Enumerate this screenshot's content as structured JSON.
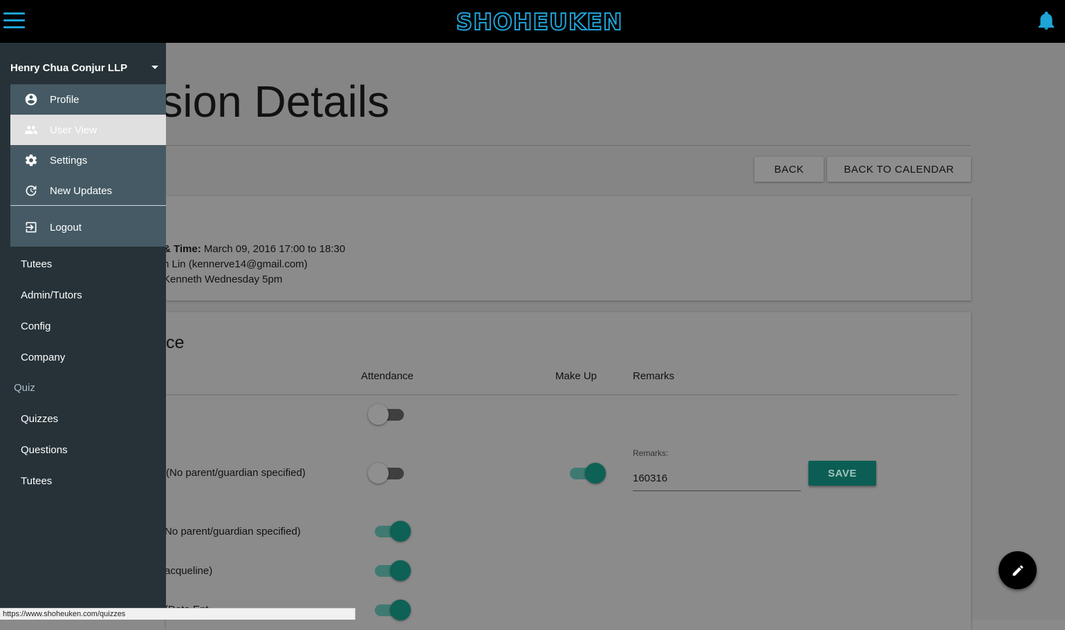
{
  "header": {
    "logo_text": "SHOHEUKEN",
    "logo_color": "#1fa4d8",
    "menu_icon": "hamburger-icon",
    "notification_icon": "bell-icon"
  },
  "drawer": {
    "account_name": "Henry Chua Conjur LLP",
    "account_menu": [
      {
        "label": "Profile",
        "icon": "account-circle-icon"
      },
      {
        "label": "User View",
        "icon": "group-icon"
      },
      {
        "label": "Settings",
        "icon": "gear-icon"
      },
      {
        "label": "New Updates",
        "icon": "update-icon"
      },
      {
        "label": "Logout",
        "icon": "logout-icon"
      }
    ],
    "nav_items": [
      "Tutees",
      "Admin/Tutors",
      "Config",
      "Company"
    ],
    "quiz_header": "Quiz",
    "quiz_items": [
      "Quizzes",
      "Questions",
      "Tutees"
    ]
  },
  "page": {
    "title": "Session Details",
    "back_label": "BACK",
    "back_calendar_label": "BACK TO CALENDAR",
    "info": {
      "datetime_label": "& Time:",
      "datetime_value": " March 09, 2016 17:00 to 18:30",
      "tutor_line": "n Lin (kennerve14@gmail.com)",
      "class_line": "Kenneth Wednesday 5pm"
    },
    "attendance_title": "ce",
    "columns": {
      "attendance": "Attendance",
      "makeup": "Make Up",
      "remarks": "Remarks"
    },
    "rows": [
      {
        "name": "",
        "attendance": false,
        "makeup": null
      },
      {
        "name": "(No parent/guardian specified)",
        "attendance": false,
        "makeup": true,
        "remarks_label": "Remarks:",
        "remarks_value": "160316",
        "save_label": "SAVE"
      },
      {
        "name": "No parent/guardian specified)",
        "attendance": true
      },
      {
        "name": "acqueline)",
        "attendance": true
      },
      {
        "name": "(Data Ent",
        "attendance": true
      }
    ],
    "fab_icon": "pencil-icon"
  },
  "status_url": "https://www.shoheuken.com/quizzes",
  "colors": {
    "accent": "#1fa4d8",
    "teal": "#0d6155",
    "drawer": "#263238",
    "menu": "#455a64"
  }
}
